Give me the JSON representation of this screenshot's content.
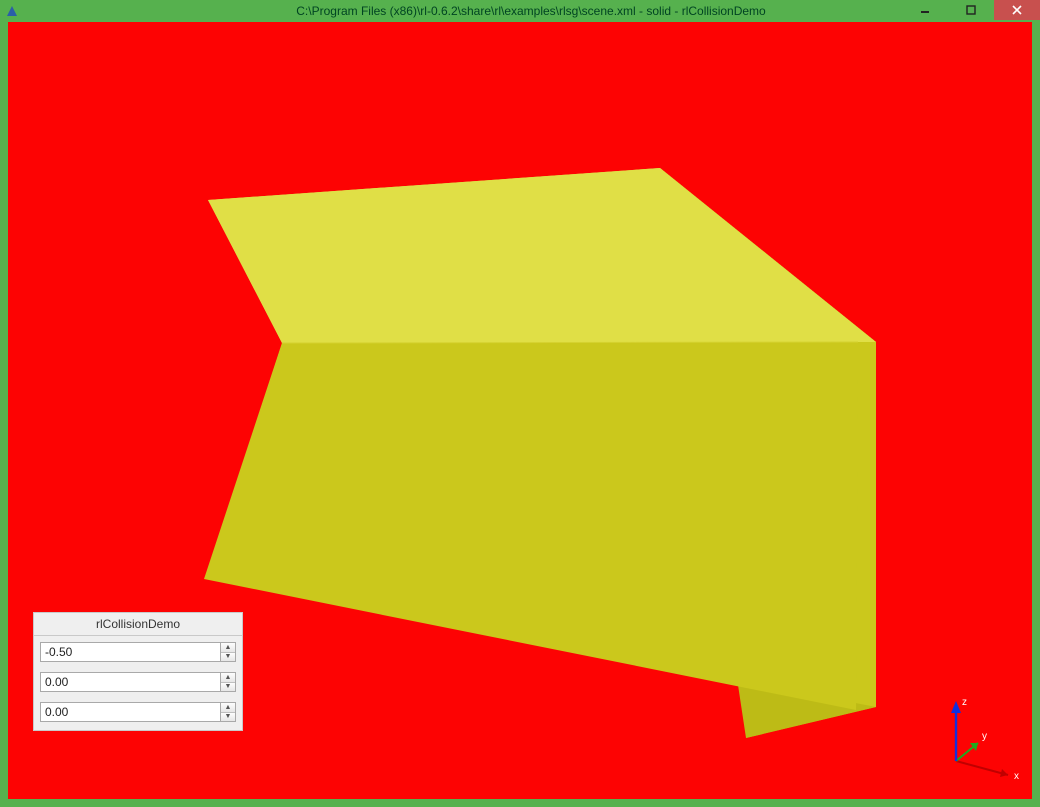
{
  "window": {
    "title": "C:\\Program Files (x86)\\rl-0.6.2\\share\\rl\\examples\\rlsg\\scene.xml - solid - rlCollisionDemo"
  },
  "viewport": {
    "background_color": "#fd0303",
    "axes": {
      "x_label": "x",
      "y_label": "y",
      "z_label": "z"
    }
  },
  "dock": {
    "title": "rlCollisionDemo",
    "fields": [
      {
        "value": "-0.50"
      },
      {
        "value": "0.00"
      },
      {
        "value": "0.00"
      }
    ]
  },
  "scene": {
    "object": "box",
    "color_top": "#e0df46",
    "color_front": "#cbc81c",
    "color_side": "#bdbb16"
  }
}
